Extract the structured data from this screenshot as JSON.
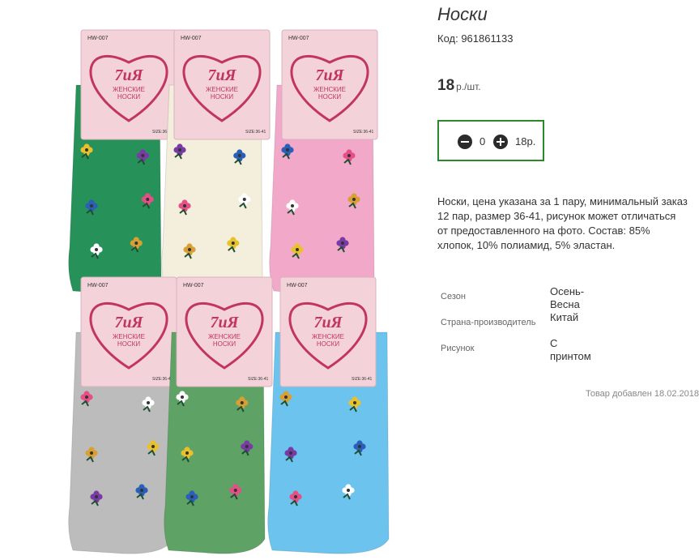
{
  "product": {
    "title": "Носки",
    "code": "Код: 961861133",
    "price": "18",
    "price_unit": "р./шт.",
    "quantity": "0",
    "sum": "18р.",
    "description": "Носки, цена указана за 1 пару, минимальный заказ 12 пар, размер 36-41, рисунок может отличаться от предоставленного на фото. Состав: 85% хлопок, 10% полиамид, 5% эластан.",
    "properties": [
      {
        "label": "Сезон",
        "value": "Осень-Весна"
      },
      {
        "label": "Страна-производитель",
        "value": "Китай"
      },
      {
        "label": "Рисунок",
        "value": "С принтом"
      }
    ],
    "added": "Товар добавлен 18.02.2018"
  },
  "tag": {
    "model": "HW-007",
    "brand": "7иЯ",
    "line1": "ЖЕНСКИЕ",
    "line2": "НОСКИ",
    "size": "SIZE:36-41"
  },
  "colors": {
    "accent_border": "#2a8a2a",
    "sock_green": "#27915a",
    "sock_cream": "#f4eedc",
    "sock_pink": "#f2a8c8",
    "sock_gray": "#bcbcbc",
    "sock_lightgreen": "#5ea266",
    "sock_blue": "#6cc3ee",
    "tag_bg": "#f3d3d9",
    "tag_heart": "#c2355f"
  }
}
